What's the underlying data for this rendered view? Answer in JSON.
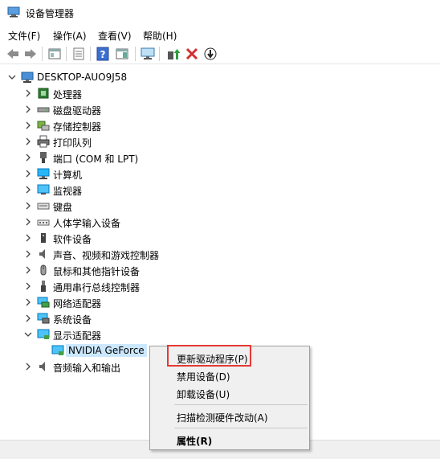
{
  "window": {
    "title": "设备管理器"
  },
  "menu": [
    "文件(F)",
    "操作(A)",
    "查看(V)",
    "帮助(H)"
  ],
  "tree": {
    "root": "DESKTOP-AUO9J58",
    "items": [
      {
        "label": "处理器",
        "icon": "processor-icon"
      },
      {
        "label": "磁盘驱动器",
        "icon": "disk-drive-icon"
      },
      {
        "label": "存储控制器",
        "icon": "storage-controller-icon"
      },
      {
        "label": "打印队列",
        "icon": "printer-icon"
      },
      {
        "label": "端口 (COM 和 LPT)",
        "icon": "port-icon"
      },
      {
        "label": "计算机",
        "icon": "computer-icon"
      },
      {
        "label": "监视器",
        "icon": "monitor-icon"
      },
      {
        "label": "键盘",
        "icon": "keyboard-icon"
      },
      {
        "label": "人体学输入设备",
        "icon": "hid-icon"
      },
      {
        "label": "软件设备",
        "icon": "software-device-icon"
      },
      {
        "label": "声音、视频和游戏控制器",
        "icon": "sound-icon"
      },
      {
        "label": "鼠标和其他指针设备",
        "icon": "mouse-icon"
      },
      {
        "label": "通用串行总线控制器",
        "icon": "usb-icon"
      },
      {
        "label": "网络适配器",
        "icon": "network-adapter-icon"
      },
      {
        "label": "系统设备",
        "icon": "system-device-icon"
      },
      {
        "label": "显示适配器",
        "icon": "display-adapter-icon"
      }
    ],
    "child": "NVIDIA GeForce",
    "after": {
      "label": "音频输入和输出",
      "icon": "audio-io-icon"
    }
  },
  "context_menu": {
    "update": "更新驱动程序(P)",
    "disable": "禁用设备(D)",
    "uninstall": "卸载设备(U)",
    "scan": "扫描检测硬件改动(A)",
    "properties": "属性(R)"
  },
  "colors": {
    "selection": "#cce8ff",
    "highlight_box": "#e53935",
    "uninstall_x": "#d32f2f"
  }
}
